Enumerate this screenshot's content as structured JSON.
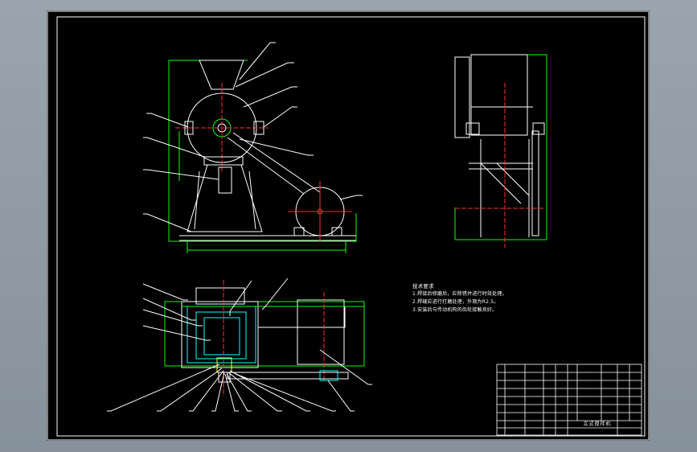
{
  "technical_requirements": {
    "title": "技术要求",
    "items": [
      "1.焊接后修磨后，应除锈并进行时效处理。",
      "2.焊缝应进行打磨处理，外观为R2.5。",
      "3.安装后与传动机构的齿轮接触良好。"
    ]
  },
  "title_block": {
    "drawing_title": "立式搅拌机"
  },
  "colors": {
    "background": "#000000",
    "outline": "#ffffff",
    "dimension": "#00ff00",
    "centerline": "#ff3030",
    "leader": "#ffffff",
    "hatch": "#00ffff",
    "accent": "#ffff00"
  }
}
